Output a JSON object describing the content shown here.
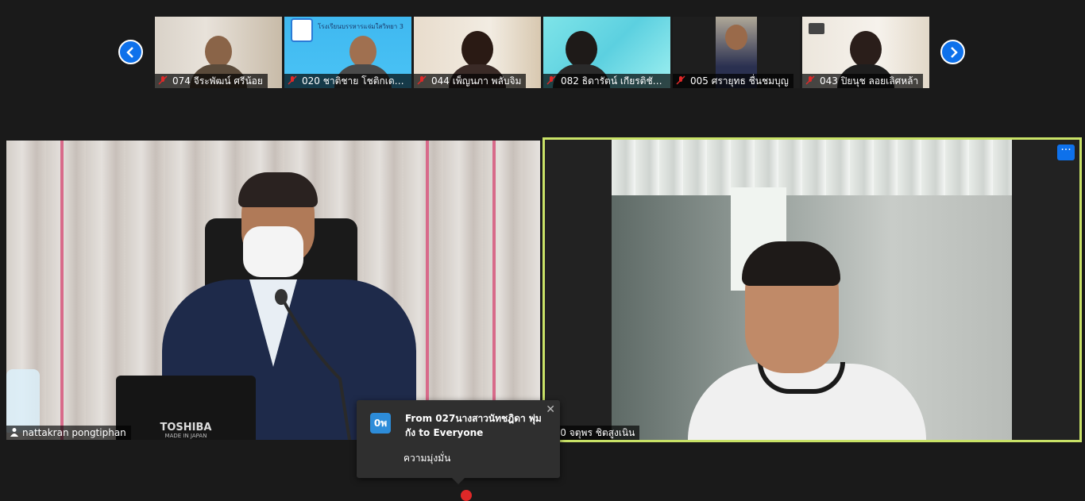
{
  "participants_strip": [
    {
      "label": "074 จีระพัฒน์ ศรีน้อย"
    },
    {
      "label": "020 ชาติชาย โชติกเดชา..."
    },
    {
      "label": "044 เพ็ญนภา  พลับจิม"
    },
    {
      "label": "082 ธิดารัตน์  เกียรติชัย..."
    },
    {
      "label": "005 ศรายุทธ ชื่นชมบุญ"
    },
    {
      "label": "043 ปิยนุช ลอยเลิศหล้า"
    }
  ],
  "thumb2_banner": "โรงเรียนบรรหารแจ่มใสวิทยา 3",
  "main_tiles": {
    "left_name": "nattakran pongtiphan",
    "left_laptop_brand": "TOSHIBA",
    "left_laptop_sub": "MADE IN JAPAN",
    "right_name": "050 จตุพร   ชิตสูงเนิน"
  },
  "chat_popup": {
    "avatar_text": "0พ",
    "from": "From 027นางสาวนัทชฎิดา  พุ่มกัง to Everyone",
    "message": "ความมุ่งมั่น",
    "close": "✕"
  },
  "colors": {
    "accent": "#0e71eb",
    "active_speaker_border": "#c9e267",
    "muted_mic": "#e02828"
  },
  "icons": {
    "prev": "chevron-left-icon",
    "next": "chevron-right-icon",
    "mic_off": "mic-off-icon",
    "more": "more-options-icon",
    "close": "close-icon"
  },
  "more_label": "···"
}
